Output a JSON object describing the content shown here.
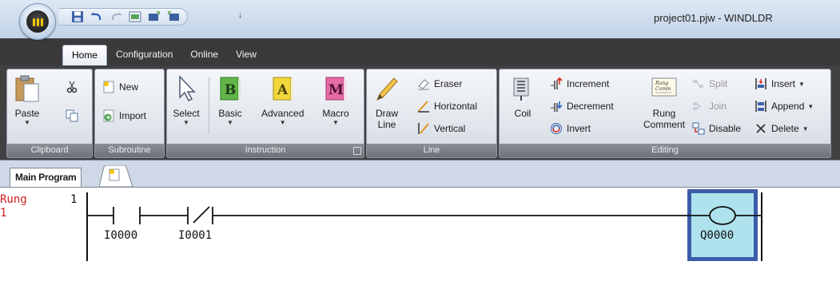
{
  "window": {
    "title": "project01.pjw - WINDLDR"
  },
  "qat": {
    "items": [
      "save-icon",
      "undo-icon",
      "redo-icon",
      "monitor-icon",
      "download-icon",
      "upload-icon"
    ],
    "dropdown": "↓"
  },
  "ribbon_tabs": [
    "Home",
    "Configuration",
    "Online",
    "View"
  ],
  "groups": {
    "clipboard": {
      "label": "Clipboard",
      "paste": "Paste"
    },
    "subroutine": {
      "label": "Subroutine",
      "new": "New",
      "import": "Import"
    },
    "instruction": {
      "label": "Instruction",
      "select": "Select",
      "basic": "Basic",
      "advanced": "Advanced",
      "macro": "Macro"
    },
    "line": {
      "label": "Line",
      "draw_line": "Draw\nLine",
      "eraser": "Eraser",
      "horizontal": "Horizontal",
      "vertical": "Vertical"
    },
    "editing": {
      "label": "Editing",
      "coil": "Coil",
      "increment": "Increment",
      "decrement": "Decrement",
      "invert": "Invert",
      "rung_comment": "Rung\nComment",
      "split": "Split",
      "join": "Join",
      "disable": "Disable",
      "insert": "Insert",
      "append": "Append",
      "delete": "Delete"
    }
  },
  "document": {
    "tab_label": "Main Program"
  },
  "ladder": {
    "rung_label": "Rung\n1",
    "rung_number": "1",
    "contacts": [
      {
        "name": "I0000",
        "type": "NO"
      },
      {
        "name": "I0001",
        "type": "NC"
      }
    ],
    "coil": {
      "name": "Q0000"
    }
  },
  "colors": {
    "rung_label": "#d21f1f",
    "coil_fill": "#aee3ee",
    "coil_border": "#3c5ba8",
    "ribbon_dark": "#414141"
  }
}
